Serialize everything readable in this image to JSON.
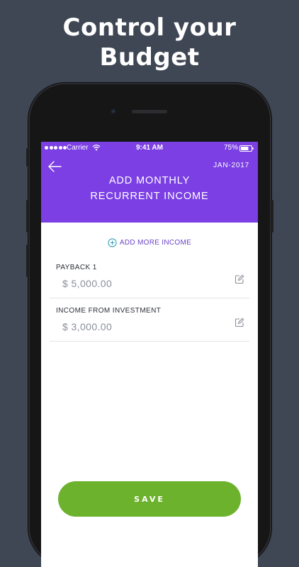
{
  "promo": {
    "headline": "Control your\nBudget"
  },
  "status_bar": {
    "carrier": "Carrier",
    "time": "9:41 AM",
    "battery": "75%",
    "battery_level": 0.75
  },
  "header": {
    "month": "JAN-2017",
    "title": "ADD MONTHLY\nRECURRENT INCOME"
  },
  "actions": {
    "add_more_income": "ADD MORE INCOME"
  },
  "income_items": [
    {
      "label": "PAYBACK 1",
      "amount": "$ 5,000.00"
    },
    {
      "label": "INCOME FROM INVESTMENT",
      "amount": "$ 3,000.00"
    }
  ],
  "footer": {
    "save_label": "SAVE"
  },
  "colors": {
    "background": "#3f4654",
    "header": "#7b3fe4",
    "accent": "#6b43c8",
    "save_button": "#6cb22d",
    "icon_teal": "#3aa0b5"
  },
  "icons": {
    "back": "back-arrow-icon",
    "add": "plus-circle-icon",
    "edit": "edit-icon",
    "wifi": "wifi-icon",
    "battery": "battery-icon"
  }
}
